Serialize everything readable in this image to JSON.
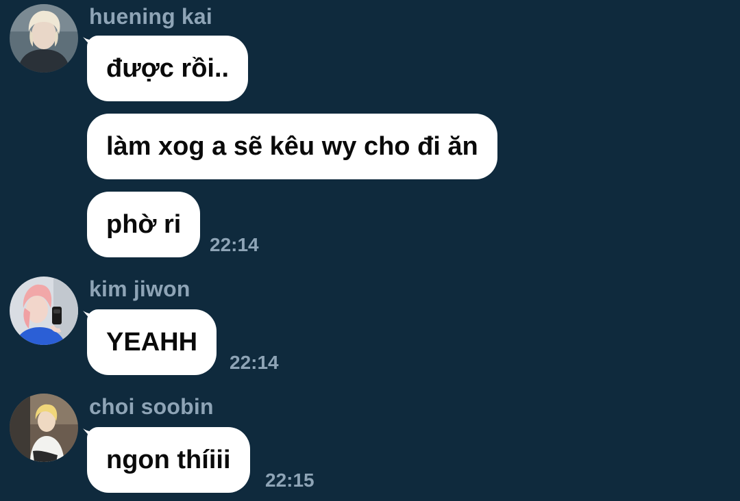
{
  "chat": {
    "groups": [
      {
        "sender": "huening kai",
        "avatar_icon": "user-avatar-photo",
        "messages": [
          "được rồi..",
          "làm xog a sẽ kêu wy cho đi ăn",
          "phờ ri"
        ],
        "time": "22:14"
      },
      {
        "sender": "kim jiwon",
        "avatar_icon": "user-avatar-photo",
        "messages": [
          "YEAHH"
        ],
        "time": "22:14"
      },
      {
        "sender": "choi soobin",
        "avatar_icon": "user-avatar-photo",
        "messages": [
          "ngon thíiii"
        ],
        "time": "22:15"
      }
    ]
  },
  "theme": {
    "background": "#0f2a3d",
    "bubble": "#ffffff",
    "meta_text": "#8ea4b6"
  }
}
